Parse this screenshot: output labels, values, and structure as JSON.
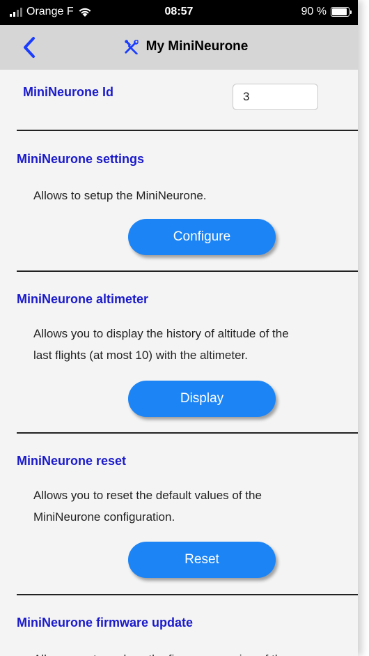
{
  "status_bar": {
    "carrier": "Orange F",
    "time": "08:57",
    "battery_text": "90 %",
    "battery_level": 0.9
  },
  "nav": {
    "back_icon": "chevron-left-icon",
    "title_icon": "tools-icon",
    "title": "My MiniNeurone",
    "accent_color": "#1a3cff"
  },
  "id_section": {
    "label": "MiniNeurone Id",
    "value": "3"
  },
  "settings": {
    "title": "MiniNeurone settings",
    "description": "Allows to setup the MiniNeurone.",
    "button": "Configure"
  },
  "altimeter": {
    "title": "MiniNeurone altimeter",
    "description_line1": "Allows you to display the history of altitude of the",
    "description_line2": "last flights (at most 10) with the altimeter.",
    "button": "Display"
  },
  "reset": {
    "title": "MiniNeurone reset",
    "description_line1": "Allows you to reset the default values of the",
    "description_line2": "MiniNeurone configuration.",
    "button": "Reset"
  },
  "firmware": {
    "title": "MiniNeurone firmware update",
    "description_line1": "Allows you to replace the firmware version of the"
  },
  "colors": {
    "section_title": "#1a1acc",
    "button": "#1c84f5",
    "nav_background": "#d6d6d6",
    "page_background": "#f4f4f4"
  }
}
